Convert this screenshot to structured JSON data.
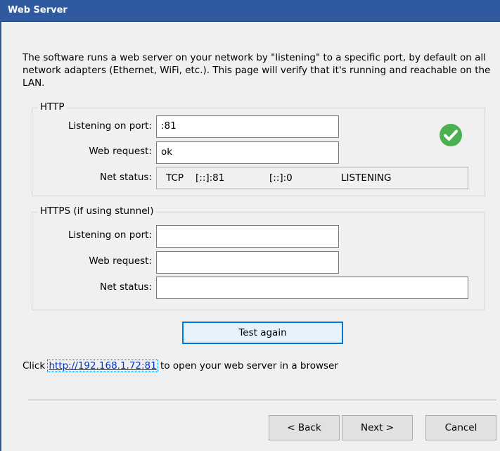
{
  "window": {
    "title": "Web Server"
  },
  "intro": "The software runs a web server on your network by \"listening\" to a specific port, by default on all network adapters (Ethernet, WiFi, etc.).  This page will verify that it's running and reachable on the LAN.",
  "http": {
    "legend": "HTTP",
    "port_label": "Listening on port:",
    "port_value": ":81",
    "request_label": "Web request:",
    "request_value": "ok",
    "net_label": "Net status:",
    "net_status": {
      "protocol": "TCP",
      "local": "[::]:81",
      "foreign": "[::]:0",
      "state": "LISTENING"
    },
    "status_icon": "check-circle-icon",
    "status_color": "#4caf50"
  },
  "https": {
    "legend": "HTTPS (if using stunnel)",
    "port_label": "Listening on port:",
    "port_value": "",
    "request_label": "Web request:",
    "request_value": "",
    "net_label": "Net status:",
    "net_value": ""
  },
  "test_button": "Test again",
  "link_line": {
    "prefix": "Click ",
    "url": "http://192.168.1.72:81",
    "suffix": " to open your web server in a browser"
  },
  "nav": {
    "back": "< Back",
    "next": "Next >",
    "cancel": "Cancel"
  },
  "colors": {
    "titlebar": "#2f5aa0",
    "accent": "#0078d7",
    "link": "#0033cc"
  }
}
